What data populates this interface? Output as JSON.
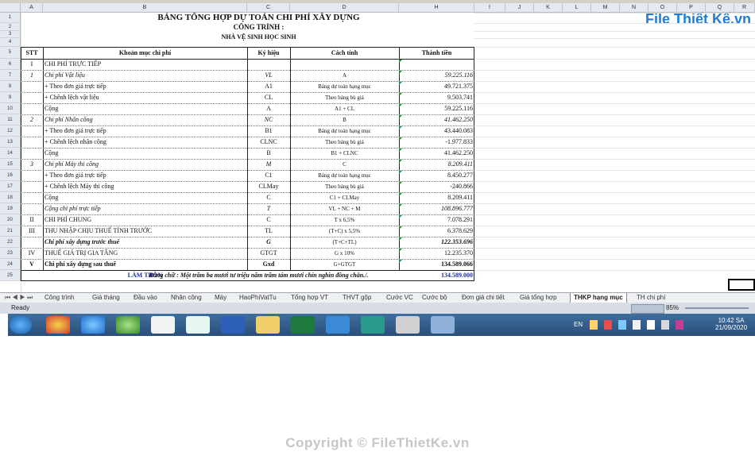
{
  "watermark": {
    "brand": "File Thiết Kế.vn",
    "copyright": "Copyright © FileThietKe.vn"
  },
  "columns": [
    "A",
    "B",
    "C",
    "D",
    "H",
    "I",
    "J",
    "K",
    "L",
    "M",
    "N",
    "O",
    "P",
    "Q",
    "R"
  ],
  "rows": [
    "1",
    "2",
    "3",
    "4",
    "5",
    "6",
    "7",
    "8",
    "9",
    "10",
    "11",
    "12",
    "13",
    "14",
    "15",
    "16",
    "17",
    "18",
    "19",
    "20",
    "21",
    "22",
    "23",
    "24",
    "25"
  ],
  "sheet": {
    "title": "BẢNG TỔNG HỢP DỰ TOÁN CHI PHÍ XÂY DỰNG",
    "subtitle": "CÔNG TRÌNH :",
    "project": "NHÀ VỆ SINH HỌC SINH",
    "headers": {
      "stt": "STT",
      "item": "Khoản mục chi phí",
      "symbol": "Ký hiệu",
      "formula": "Cách tính",
      "amount": "Thành tiền"
    },
    "rows": [
      {
        "stt": "I",
        "item": "CHI PHÍ TRỰC TIẾP",
        "symbol": "",
        "formula": "",
        "amount": "",
        "style": ""
      },
      {
        "stt": "1",
        "item": "Chi phí Vật liệu",
        "symbol": "VL",
        "formula": "A",
        "amount": "59.225.116",
        "style": "i"
      },
      {
        "stt": "",
        "item": "+ Theo đơn giá trực tiếp",
        "symbol": "A1",
        "formula": "Bảng dự toán hạng mục",
        "amount": "49.721.375",
        "style": ""
      },
      {
        "stt": "",
        "item": "+ Chênh lệch vật liệu",
        "symbol": "CL",
        "formula": "Theo bảng bù giá",
        "amount": "9.503.741",
        "style": ""
      },
      {
        "stt": "",
        "item": "Cộng",
        "symbol": "A",
        "formula": "A1 + CL",
        "amount": "59.225.116",
        "style": ""
      },
      {
        "stt": "2",
        "item": "Chi phí Nhân công",
        "symbol": "NC",
        "formula": "B",
        "amount": "41.462.250",
        "style": "i"
      },
      {
        "stt": "",
        "item": "+ Theo đơn giá trực tiếp",
        "symbol": "B1",
        "formula": "Bảng dự toán hạng mục",
        "amount": "43.440.083",
        "style": ""
      },
      {
        "stt": "",
        "item": "+ Chênh lệch nhân công",
        "symbol": "CLNC",
        "formula": "Theo bảng bù giá",
        "amount": "-1.977.833",
        "style": ""
      },
      {
        "stt": "",
        "item": "Cộng",
        "symbol": "B",
        "formula": "B1 + CLNC",
        "amount": "41.462.250",
        "style": ""
      },
      {
        "stt": "3",
        "item": "Chi phí Máy thi công",
        "symbol": "M",
        "formula": "C",
        "amount": "8.209.411",
        "style": "i"
      },
      {
        "stt": "",
        "item": "+ Theo đơn giá trực tiếp",
        "symbol": "C1",
        "formula": "Bảng dự toán hạng mục",
        "amount": "8.450.277",
        "style": ""
      },
      {
        "stt": "",
        "item": "+ Chênh lệch Máy thi công",
        "symbol": "CLMay",
        "formula": "Theo bảng bù giá",
        "amount": "-240.866",
        "style": ""
      },
      {
        "stt": "",
        "item": "Cộng",
        "symbol": "C",
        "formula": "C1 + CLMay",
        "amount": "8.209.411",
        "style": ""
      },
      {
        "stt": "",
        "item": "Cộng chi phí trực tiếp",
        "symbol": "T",
        "formula": "VL + NC + M",
        "amount": "108.896.777",
        "style": "i"
      },
      {
        "stt": "II",
        "item": "CHI PHÍ CHUNG",
        "symbol": "C",
        "formula": "T x 6,5%",
        "amount": "7.078.291",
        "style": ""
      },
      {
        "stt": "III",
        "item": "THU NHẬP CHỊU THUẾ TÍNH TRƯỚC",
        "symbol": "TL",
        "formula": "(T+C) x 5,5%",
        "amount": "6.378.629",
        "style": ""
      },
      {
        "stt": "",
        "item": "Chi phí xây dựng trước thuế",
        "symbol": "G",
        "formula": "(T+C+TL)",
        "amount": "122.353.696",
        "style": "bi"
      },
      {
        "stt": "IV",
        "item": "THUẾ GIÁ TRỊ GIA TĂNG",
        "symbol": "GTGT",
        "formula": "G x 10%",
        "amount": "12.235.370",
        "style": ""
      },
      {
        "stt": "V",
        "item": "Chi phí xây dựng sau thuế",
        "symbol": "Gxd",
        "formula": "G+GTGT",
        "amount": "134.589.066",
        "style": "b"
      },
      {
        "stt": "",
        "item": "LÀM TRÒN",
        "symbol": "",
        "formula": "",
        "amount": "134.589.000",
        "style": "round"
      }
    ],
    "words": "Bằng chữ : Một trăm ba mươi tư triệu năm trăm tám mươi chín nghìn đồng chẵn./."
  },
  "tabs": [
    "Công trình",
    "Giá tháng",
    "Đầu vào",
    "Nhân công",
    "Máy",
    "HaoPhiVatTu",
    "Tổng hợp VT",
    "THVT gộp",
    "Cước VC",
    "Cước bộ",
    "Đơn giá chi tiết",
    "Giá tổng hợp",
    "THKP hạng mục",
    "TH chi phí"
  ],
  "active_tab": "THKP hạng mục",
  "status": {
    "ready": "Ready",
    "zoom": "85%"
  },
  "tray": {
    "lang": "EN",
    "time": "10:42 SA",
    "date": "21/09/2020"
  },
  "colors": {
    "header_bg": "#e4e8ef",
    "taskbar": "#2f5a88",
    "accent_blue": "#1f2fa0",
    "triangle": "#1a8a3a"
  }
}
